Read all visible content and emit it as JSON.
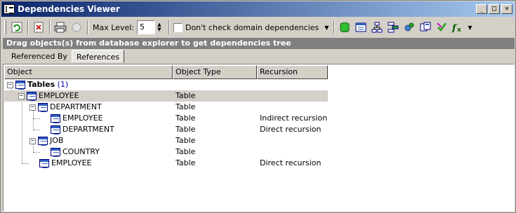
{
  "window": {
    "title": "Dependencies Viewer",
    "buttons": [
      "_",
      "□",
      "×"
    ]
  },
  "toolbar": {
    "icons": [
      "refresh-icon",
      "clear-icon",
      "print-icon",
      "stop-icon"
    ],
    "max_level_label": "Max Level:",
    "max_level_value": "5",
    "domain_checkbox_label": "Don't check domain dependencies",
    "right_icons": [
      "database-icon",
      "table-view-icon",
      "tree-view-icon",
      "diagram-icon",
      "settings-icon",
      "export-icon",
      "check-icon",
      "function-icon"
    ]
  },
  "banner": {
    "text": "Drag objects(s) from database explorer to get dependencies tree"
  },
  "tabs": [
    {
      "label": "Referenced By"
    },
    {
      "label": "References"
    }
  ],
  "columns": [
    {
      "label": "Object"
    },
    {
      "label": "Object Type"
    },
    {
      "label": "Recursion"
    }
  ],
  "root": {
    "label": "Tables",
    "count": "(1)"
  },
  "rows": [
    {
      "name": "EMPLOYEE",
      "type": "Table",
      "recursion": ""
    },
    {
      "name": "DEPARTMENT",
      "type": "Table",
      "recursion": ""
    },
    {
      "name": "EMPLOYEE",
      "type": "Table",
      "recursion": "Indirect recursion"
    },
    {
      "name": "DEPARTMENT",
      "type": "Table",
      "recursion": "Direct recursion"
    },
    {
      "name": "JOB",
      "type": "Table",
      "recursion": ""
    },
    {
      "name": "COUNTRY",
      "type": "Table",
      "recursion": ""
    },
    {
      "name": "EMPLOYEE",
      "type": "Table",
      "recursion": "Direct recursion"
    }
  ],
  "colors": {
    "title_start": "#0a246a",
    "title_end": "#a6caf0",
    "banner": "#808080",
    "selection": "#d4d0c8"
  }
}
